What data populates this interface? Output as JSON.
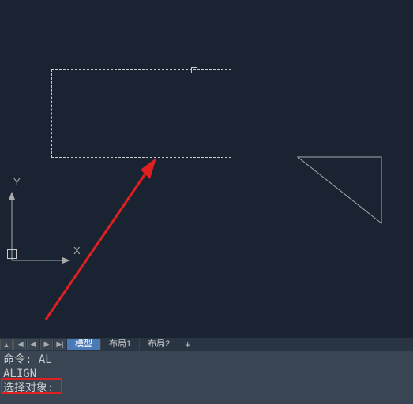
{
  "canvas": {
    "ucs": {
      "x_label": "X",
      "y_label": "Y"
    }
  },
  "tabs": {
    "nav_first": "▲",
    "nav_prev_all": "|◀",
    "nav_prev": "◀",
    "nav_next": "▶",
    "nav_next_all": "▶|",
    "model": "模型",
    "layout1": "布局1",
    "layout2": "布局2",
    "add": "+"
  },
  "command": {
    "line1": "命令: AL",
    "line2": "ALIGN",
    "line3": "选择对象:"
  }
}
